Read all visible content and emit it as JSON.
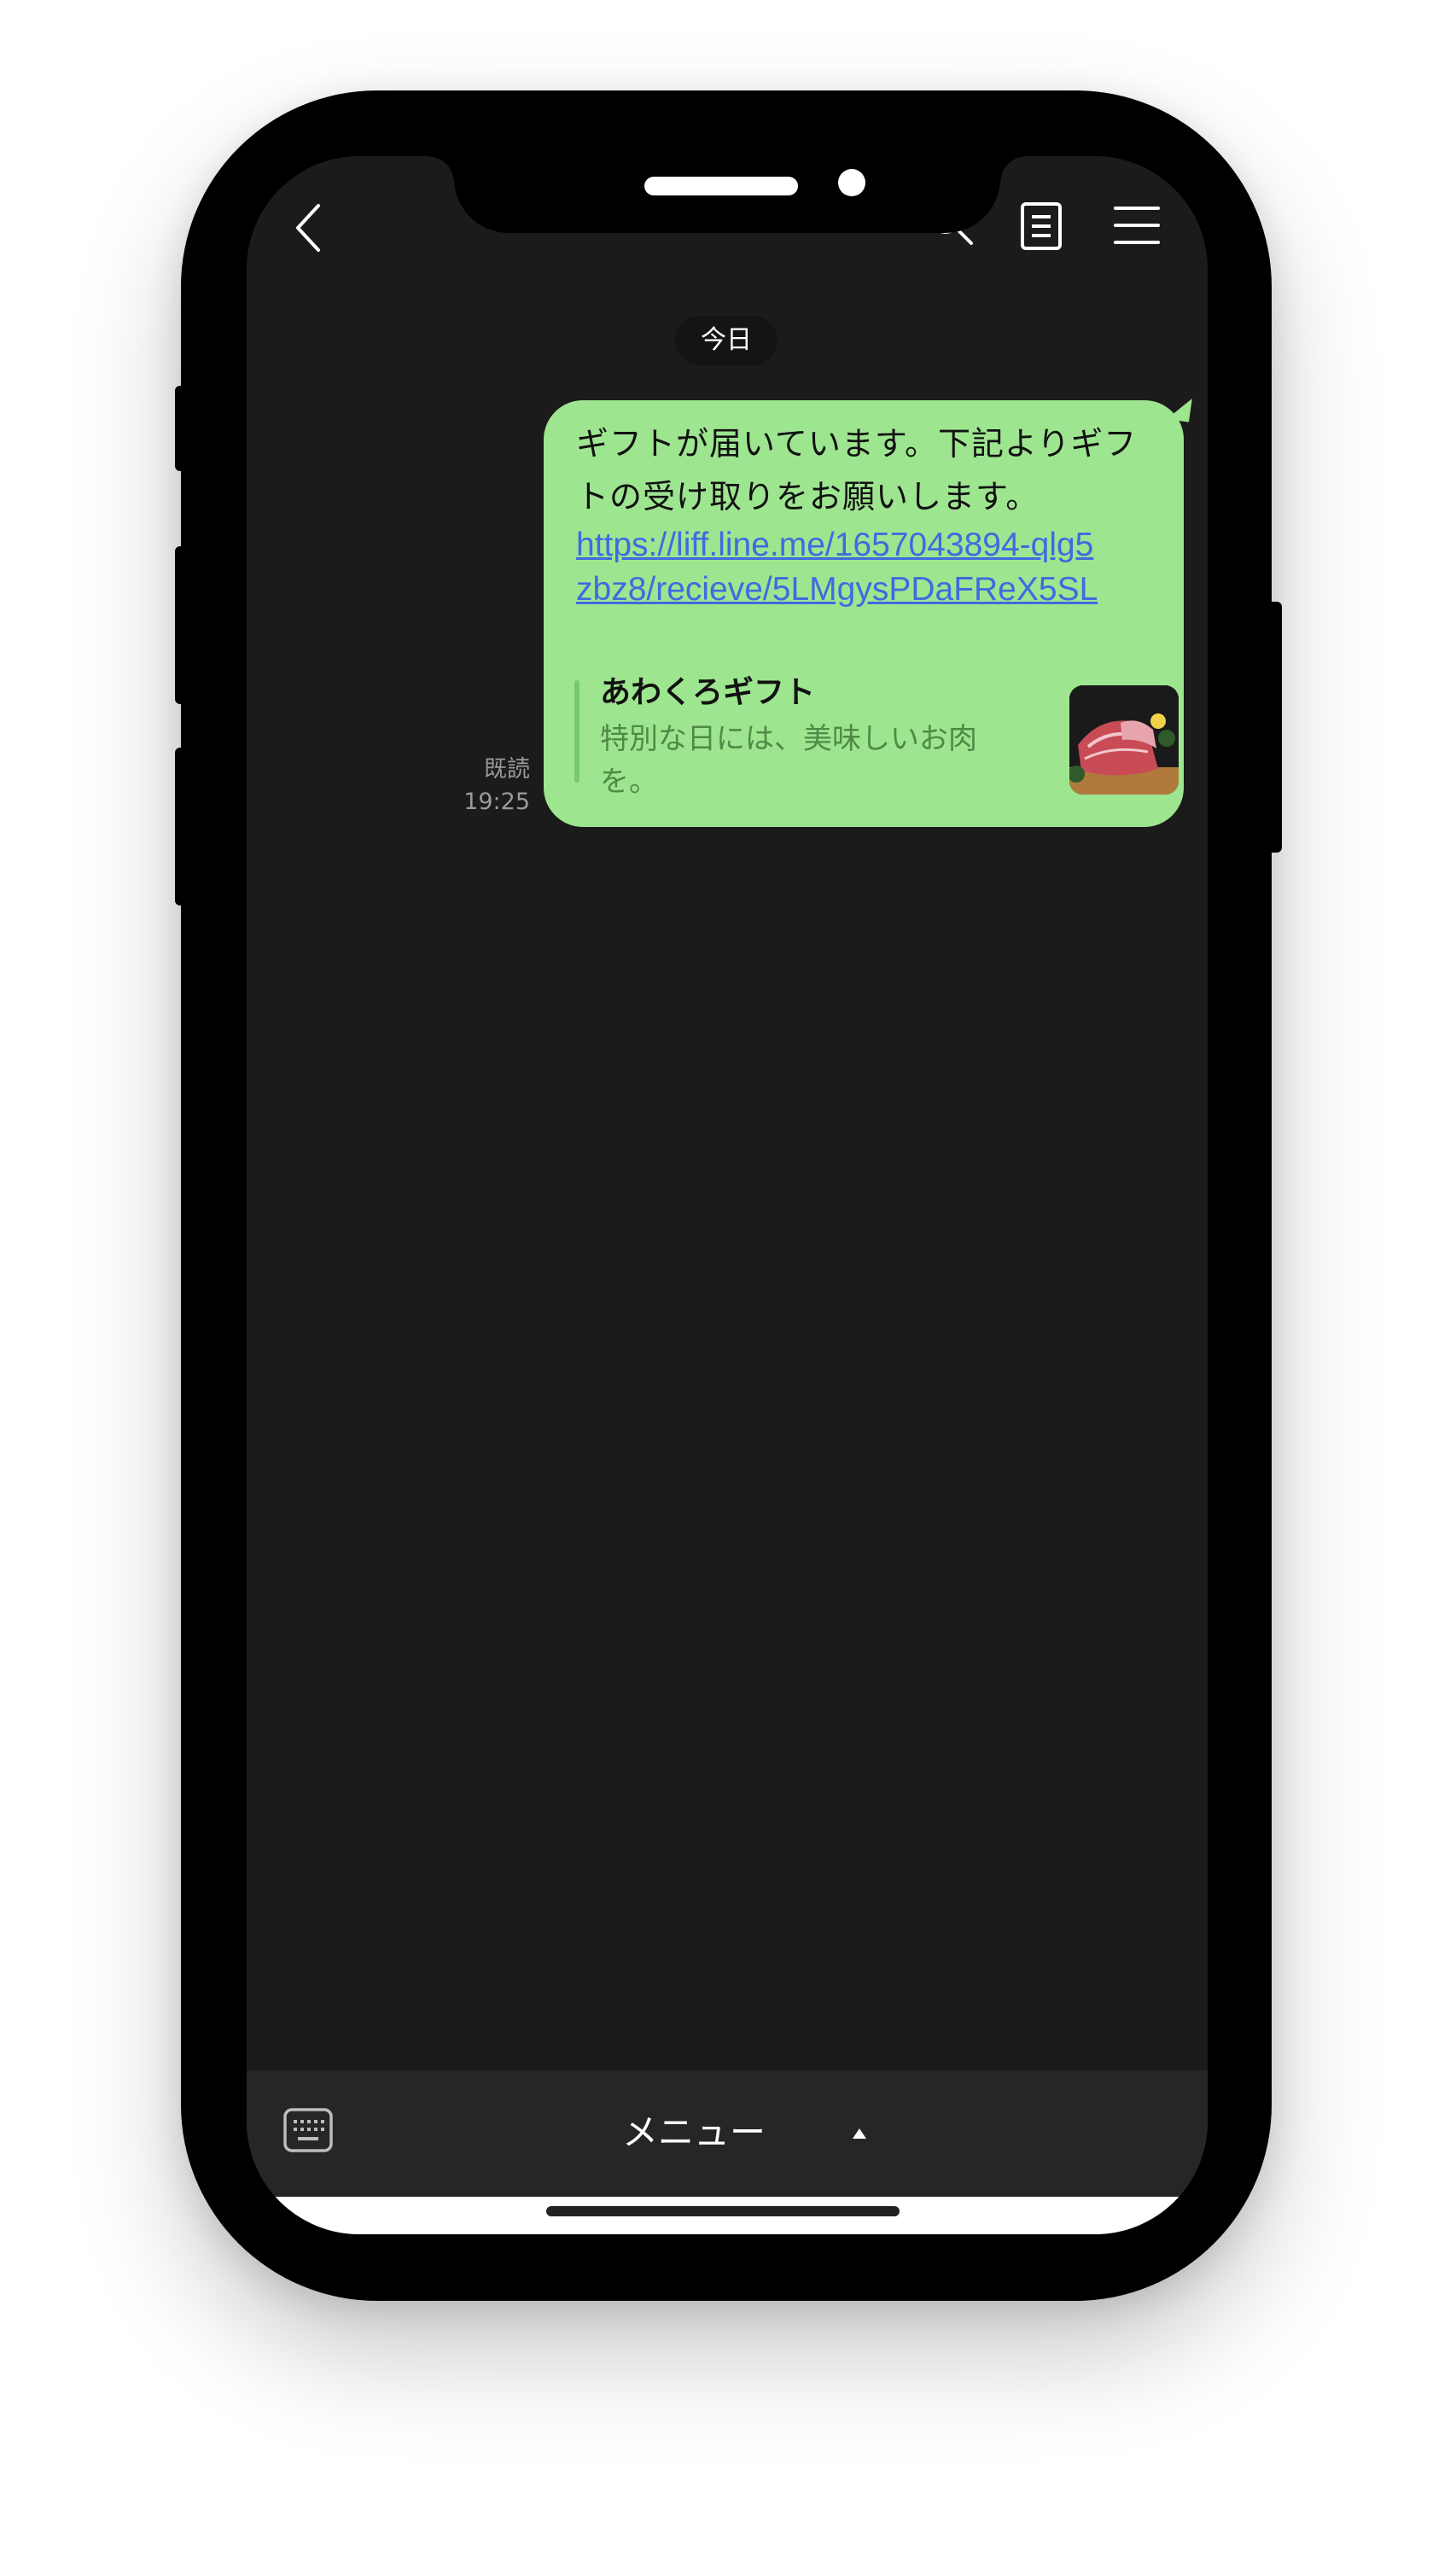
{
  "date_divider": "今日",
  "message": {
    "text": "ギフトが届いています。下記よりギフトの受け取りをお願いします。",
    "link": "https://liff.line.me/1657043894-qlg5zbz8/recieve/5LMgysPDaFReX5SL",
    "read_label": "既読",
    "time": "19:25",
    "preview": {
      "title": "あわくろギフト",
      "description": "特別な日には、美味しいお肉を。"
    }
  },
  "bottom_bar": {
    "menu_label": "メニュー"
  },
  "colors": {
    "background": "#1b1b1b",
    "bubble": "#9ee590",
    "link": "#3d6ce0",
    "preview_bar": "#78c86c",
    "bottom_bar": "#262626"
  },
  "icons": [
    "back-icon",
    "search-icon",
    "notes-icon",
    "menu-icon",
    "keyboard-icon",
    "caret-up-icon"
  ]
}
